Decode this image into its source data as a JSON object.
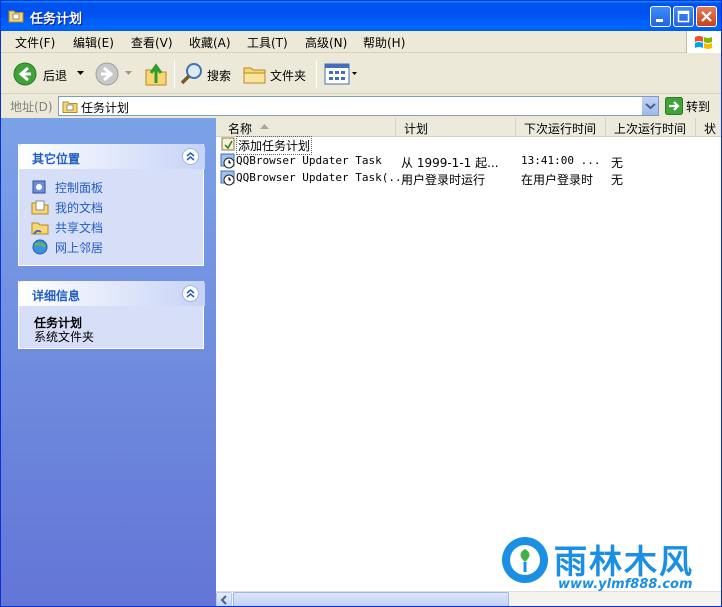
{
  "window": {
    "title": "任务计划"
  },
  "menu": [
    "文件(F)",
    "编辑(E)",
    "查看(V)",
    "收藏(A)",
    "工具(T)",
    "高级(N)",
    "帮助(H)"
  ],
  "toolbar": {
    "back": "后退",
    "search": "搜索",
    "folders": "文件夹"
  },
  "address": {
    "label": "地址(D)",
    "value": "任务计划",
    "go": "转到"
  },
  "sidebar": {
    "other_places": {
      "title": "其它位置",
      "links": [
        "控制面板",
        "我的文档",
        "共享文档",
        "网上邻居"
      ]
    },
    "details": {
      "title": "详细信息",
      "name": "任务计划",
      "type": "系统文件夹"
    }
  },
  "columns": [
    "名称",
    "计划",
    "下次运行时间",
    "上次运行时间",
    "状"
  ],
  "rows": [
    {
      "name": "添加任务计划",
      "schedule": "",
      "next": "",
      "last": ""
    },
    {
      "name": "QQBrowser Updater Task",
      "schedule": "从 1999-1-1 起...",
      "next": "13:41:00  ...",
      "last": "无"
    },
    {
      "name": "QQBrowser Updater Task(...",
      "schedule": "用户登录时运行",
      "next": "在用户登录时",
      "last": "无"
    }
  ],
  "watermark": {
    "brand": "雨林木风",
    "url": "www.ylmf888.com"
  }
}
